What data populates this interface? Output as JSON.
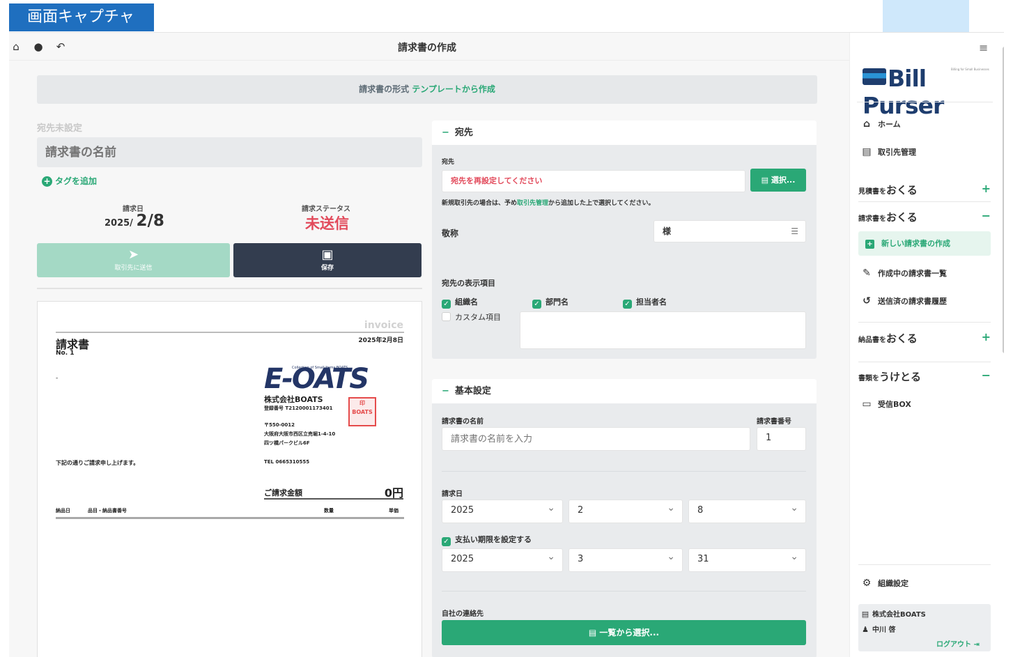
{
  "caption": "画面キャプチャ",
  "header": {
    "title": "請求書の作成"
  },
  "format_bar": {
    "label": "請求書の形式",
    "link": "テンプレートから作成"
  },
  "left": {
    "recipient_unset": "宛先未設定",
    "name_placeholder": "請求書の名前",
    "add_tag": "タグを追加",
    "date_label": "請求日",
    "date_year": "2025/",
    "date_md": "2/8",
    "status_label": "請求ステータス",
    "status_value": "未送信",
    "send_label": "取引先に送信",
    "save_label": "保存"
  },
  "preview": {
    "invoice_word": "invoice",
    "title": "請求書",
    "no": "No. 1",
    "issue_date": "2025年2月8日",
    "to_suffix": "-",
    "logo_text": "E-OATS",
    "logo_tagline": "Collection of Small Items BOATS",
    "company": "株式会社BOATS",
    "reg_no": "登録番号 T2120001173401",
    "zip": "〒550-0012",
    "address": "大阪府大阪市西区立売堀1-4-10",
    "building": "四ツ橋パークビル6F",
    "tel": "TEL 0665310555",
    "stamp": "BOATS",
    "note": "下記の通りご請求申し上げます。",
    "amount_label": "ご請求金額",
    "amount": "0円",
    "col_date": "納品日",
    "col_item": "品目・納品書番号",
    "col_qty": "数量",
    "col_price": "単価"
  },
  "recipient_card": {
    "title": "宛先",
    "field_label": "宛先",
    "field_value": "宛先を再設定してください",
    "select_button": "選択...",
    "hint_pre": "新規取引先の場合は、予め",
    "hint_link": "取引先管理",
    "hint_post": "から追加した上で選択してください。",
    "honorific_label": "敬称",
    "honorific_value": "様",
    "display_label": "宛先の表示項目",
    "check_org": "組織名",
    "check_dept": "部門名",
    "check_person": "担当者名",
    "check_custom": "カスタム項目"
  },
  "basic_card": {
    "title": "基本設定",
    "name_label": "請求書の名前",
    "name_placeholder": "請求書の名前を入力",
    "number_label": "請求書番号",
    "number_value": "1",
    "date_label": "請求日",
    "date_year": "2025",
    "date_month": "2",
    "date_day": "8",
    "due_check": "支払い期限を設定する",
    "due_year": "2025",
    "due_month": "3",
    "due_day": "31",
    "contact_label": "自社の連絡先",
    "contact_button": "一覧から選択..."
  },
  "sidebar": {
    "logo": "Bill Purser",
    "logo_sub": "Billing for Small Businesses",
    "home": "ホーム",
    "clients": "取引先管理",
    "estimate_prefix": "見積書を",
    "estimate_main": "おくる",
    "invoice_prefix": "請求書を",
    "invoice_main": "おくる",
    "new_invoice": "新しい請求書の作成",
    "drafts": "作成中の請求書一覧",
    "sent_history": "送信済の請求書履歴",
    "delivery_prefix": "納品書を",
    "delivery_main": "おくる",
    "receive_prefix": "書類を",
    "receive_main": "うけとる",
    "inbox": "受信BOX",
    "settings": "組織設定",
    "org": "株式会社BOATS",
    "user": "中川 啓",
    "logout": "ログアウト"
  },
  "colors": {
    "accent": "#2aa876",
    "navy": "#333d4f",
    "danger": "#e24a5b",
    "caption_blue": "#1f6fbf"
  }
}
